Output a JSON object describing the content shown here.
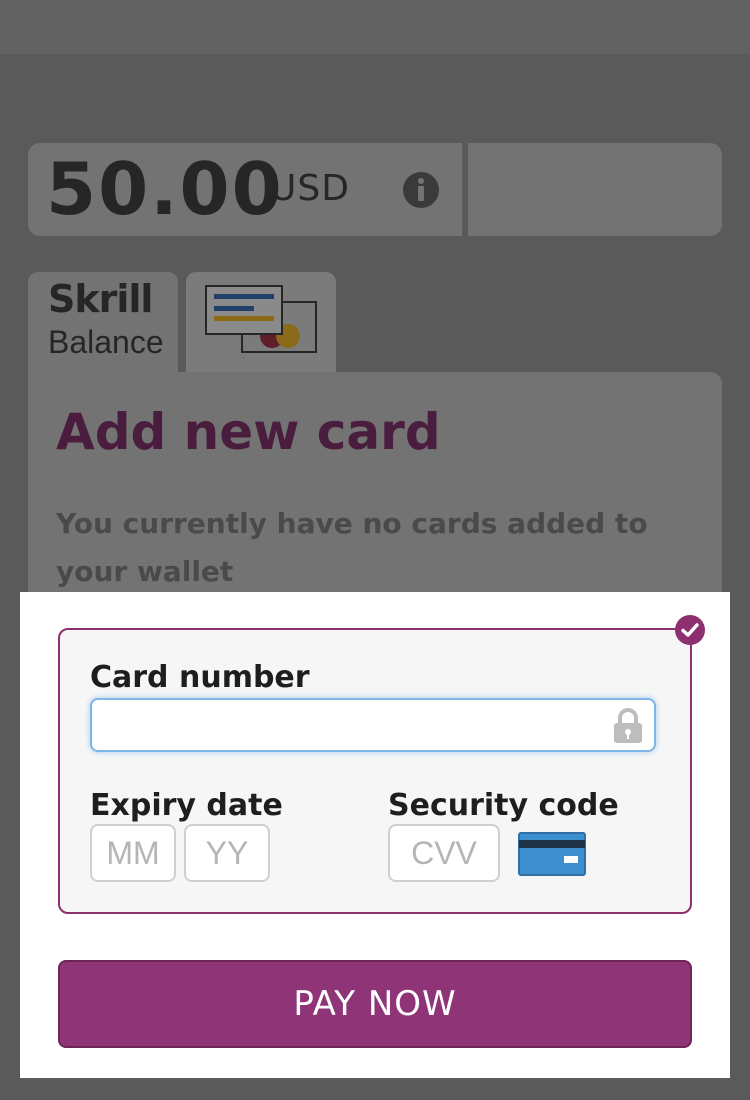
{
  "amount": {
    "value": "50.00",
    "currency": "USD",
    "info_icon": "info-icon"
  },
  "tabs": [
    {
      "brand": "Skrill",
      "label": "Balance",
      "icon": "skrill-logo"
    },
    {
      "label": "",
      "icon": "credit-card-tab-icon"
    }
  ],
  "panel": {
    "title": "Add new card",
    "subtitle": "You currently have no cards added to your wallet"
  },
  "form": {
    "card_number_label": "Card number",
    "card_number_value": "",
    "expiry_label": "Expiry date",
    "expiry_month_placeholder": "MM",
    "expiry_year_placeholder": "YY",
    "security_label": "Security code",
    "cvv_placeholder": "CVV"
  },
  "pay_button_label": "PAY NOW",
  "colors": {
    "brand_purple": "#8f3476",
    "overlay_gray": "#5a5a5a",
    "input_focus": "#7fb6e8",
    "card_icon_blue": "#3d8fcf"
  }
}
